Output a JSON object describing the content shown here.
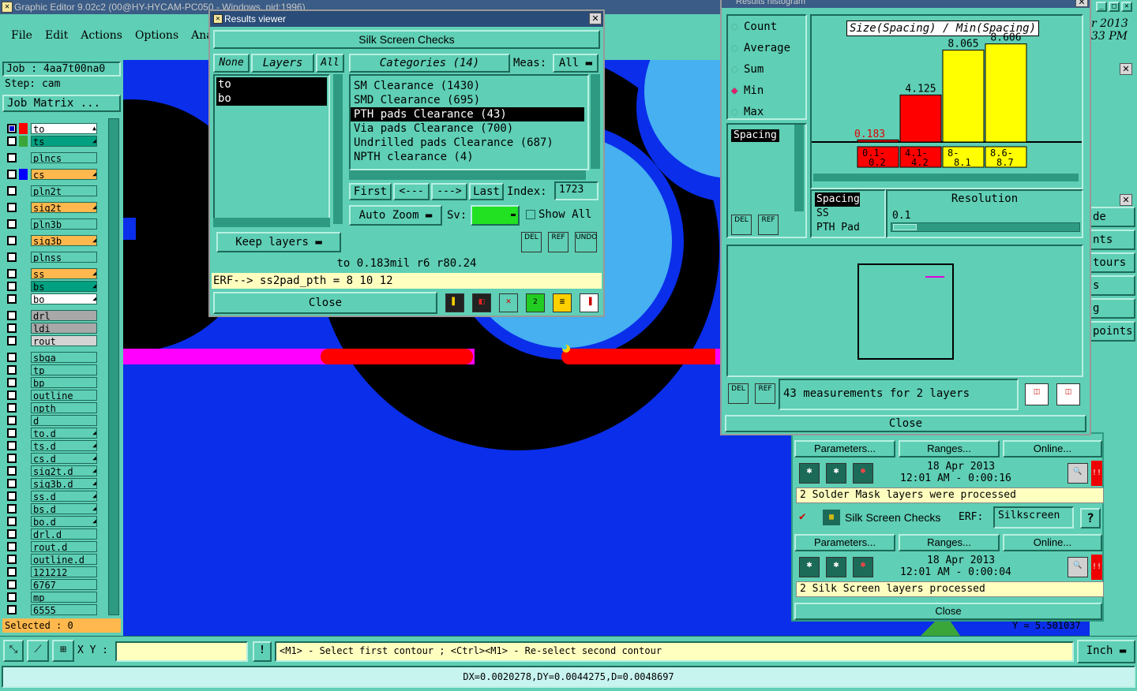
{
  "app": {
    "title": "Graphic Editor 9.02c2 (00@HY-HYCAM-PC050 - Windows, pid:1996)",
    "date_partial": "r 2013",
    "time_partial": "33 PM"
  },
  "menu": [
    "File",
    "Edit",
    "Actions",
    "Options",
    "Analy"
  ],
  "job": {
    "job_label": "Job : 4aa7t00na0",
    "step_label": "Step: cam",
    "matrix_button": "Job Matrix ..."
  },
  "layers": [
    {
      "name": "to",
      "color": "#ff0000",
      "bg": "#ffffff",
      "mark": "▲"
    },
    {
      "name": "ts",
      "color": "#3aa63a",
      "bg": "#00a080",
      "mark": "◢"
    },
    {
      "name": "plncs",
      "color": "",
      "bg": "#5fcfb5",
      "mark": ""
    },
    {
      "name": "cs",
      "color": "#0000ff",
      "bg": "#ffb84d",
      "mark": "◢"
    },
    {
      "name": "pln2t",
      "color": "",
      "bg": "#5fcfb5",
      "mark": ""
    },
    {
      "name": "sig2t",
      "color": "",
      "bg": "#ffb84d",
      "mark": "◢"
    },
    {
      "name": "pln3b",
      "color": "",
      "bg": "#5fcfb5",
      "mark": ""
    },
    {
      "name": "sig3b",
      "color": "",
      "bg": "#ffb84d",
      "mark": "◢"
    },
    {
      "name": "plnss",
      "color": "",
      "bg": "#5fcfb5",
      "mark": ""
    },
    {
      "name": "ss",
      "color": "",
      "bg": "#ffb84d",
      "mark": "◢"
    },
    {
      "name": "bs",
      "color": "",
      "bg": "#00a080",
      "mark": "◢"
    },
    {
      "name": "bo",
      "color": "",
      "bg": "#ffffff",
      "mark": "◢"
    },
    {
      "name": "drl",
      "color": "",
      "bg": "#a8a8a8",
      "mark": ""
    },
    {
      "name": "ldi",
      "color": "",
      "bg": "#a8a8a8",
      "mark": ""
    },
    {
      "name": "rout",
      "color": "",
      "bg": "#d4d4d4",
      "mark": ""
    },
    {
      "name": "sbga",
      "color": "",
      "bg": "#5fcfb5",
      "mark": ""
    },
    {
      "name": "tp",
      "color": "",
      "bg": "#5fcfb5",
      "mark": ""
    },
    {
      "name": "bp",
      "color": "",
      "bg": "#5fcfb5",
      "mark": ""
    },
    {
      "name": "outline",
      "color": "",
      "bg": "#5fcfb5",
      "mark": ""
    },
    {
      "name": "npth",
      "color": "",
      "bg": "#5fcfb5",
      "mark": ""
    },
    {
      "name": "d",
      "color": "",
      "bg": "#5fcfb5",
      "mark": ""
    },
    {
      "name": "to.d",
      "color": "",
      "bg": "#5fcfb5",
      "mark": "◢"
    },
    {
      "name": "ts.d",
      "color": "",
      "bg": "#5fcfb5",
      "mark": "◢"
    },
    {
      "name": "cs.d",
      "color": "",
      "bg": "#5fcfb5",
      "mark": "◢"
    },
    {
      "name": "sig2t.d",
      "color": "",
      "bg": "#5fcfb5",
      "mark": "◢"
    },
    {
      "name": "sig3b.d",
      "color": "",
      "bg": "#5fcfb5",
      "mark": "◢"
    },
    {
      "name": "ss.d",
      "color": "",
      "bg": "#5fcfb5",
      "mark": "◢"
    },
    {
      "name": "bs.d",
      "color": "",
      "bg": "#5fcfb5",
      "mark": "◢"
    },
    {
      "name": "bo.d",
      "color": "",
      "bg": "#5fcfb5",
      "mark": "◢"
    },
    {
      "name": "drl.d",
      "color": "",
      "bg": "#5fcfb5",
      "mark": ""
    },
    {
      "name": "rout.d",
      "color": "",
      "bg": "#5fcfb5",
      "mark": ""
    },
    {
      "name": "outline.d",
      "color": "",
      "bg": "#5fcfb5",
      "mark": ""
    },
    {
      "name": "121212",
      "color": "",
      "bg": "#5fcfb5",
      "mark": ""
    },
    {
      "name": "6767",
      "color": "",
      "bg": "#5fcfb5",
      "mark": ""
    },
    {
      "name": "mp",
      "color": "",
      "bg": "#5fcfb5",
      "mark": ""
    },
    {
      "name": "6555",
      "color": "",
      "bg": "#5fcfb5",
      "mark": ""
    }
  ],
  "selected_label": "Selected : 0",
  "viewer": {
    "title": "Results viewer",
    "close_x": "✕",
    "header": "Silk Screen Checks",
    "none": "None",
    "layers": "Layers",
    "all": "All",
    "categories_btn": "Categories (14)",
    "meas_label": "Meas:",
    "meas_value": "All",
    "layer_list": [
      "to",
      "bo"
    ],
    "categories": [
      "SM Clearance (1430)",
      "SMD Clearance (695)",
      "PTH pads Clearance (43)",
      "Via pads Clearance (700)",
      "Undrilled pads Clearance (687)",
      "NPTH clearance (4)"
    ],
    "first": "First",
    "prev": "<---",
    "next": "--->",
    "last": "Last",
    "index_label": "Index:",
    "index_value": "1723",
    "auto_zoom": "Auto Zoom",
    "sv_label": "Sv:",
    "show_all": "Show All",
    "keep_layers": "Keep layers",
    "del": "DEL",
    "ref": "REF",
    "undo": "UNDO",
    "info": "to 0.183mil  r6  r80.24",
    "erf": "ERF--> ss2pad_pth = 8 10 12",
    "close": "Close"
  },
  "histogram": {
    "title": "Results histogram",
    "options": [
      "Count",
      "Average",
      "Sum",
      "Min",
      "Max"
    ],
    "selected_option": "Min",
    "chart_title": "Size(Spacing) / Min(Spacing)",
    "spacing_item": "Spacing",
    "meas_list": [
      "Spacing",
      "SS",
      "PTH Pad"
    ],
    "resolution_label": "Resolution",
    "resolution_value": "0.1",
    "status": "43 measurements for 2 layers",
    "close": "Close",
    "del": "DEL",
    "ref": "REF"
  },
  "chart_data": {
    "type": "bar",
    "title": "Size(Spacing) / Min(Spacing)",
    "categories": [
      "0.1-0.2",
      "4.1-4.2",
      "8-8.1",
      "8.6-8.7"
    ],
    "values": [
      0.183,
      4.125,
      8.065,
      8.606
    ],
    "colors": [
      "#ff0000",
      "#ff0000",
      "#ffff00",
      "#ffff00"
    ],
    "ylim": [
      0,
      9
    ]
  },
  "checks": {
    "params": "Parameters...",
    "ranges": "Ranges...",
    "online": "Online...",
    "date1": "18 Apr 2013",
    "time1": "12:01 AM - 0:00:16",
    "msg1": "2 Solder Mask layers were processed",
    "check_name": "Silk Screen Checks",
    "erf_label": "ERF:",
    "erf_value": "Silkscreen",
    "help": "?",
    "date2": "18 Apr 2013",
    "time2": "12:01 AM - 0:00:04",
    "msg2": "2 Silk Screen layers processed",
    "close": "Close"
  },
  "side_menu": [
    "de",
    "nts",
    "tours",
    "s",
    "g",
    "points"
  ],
  "coord_partial": "Y = 5.501037",
  "bottom": {
    "xy_label": "X Y :",
    "hint": "<M1> - Select first contour ; <Ctrl><M1> - Re-select second contour",
    "units": "Inch",
    "status": "DX=0.0020278,DY=0.0044275,D=0.0048697"
  }
}
